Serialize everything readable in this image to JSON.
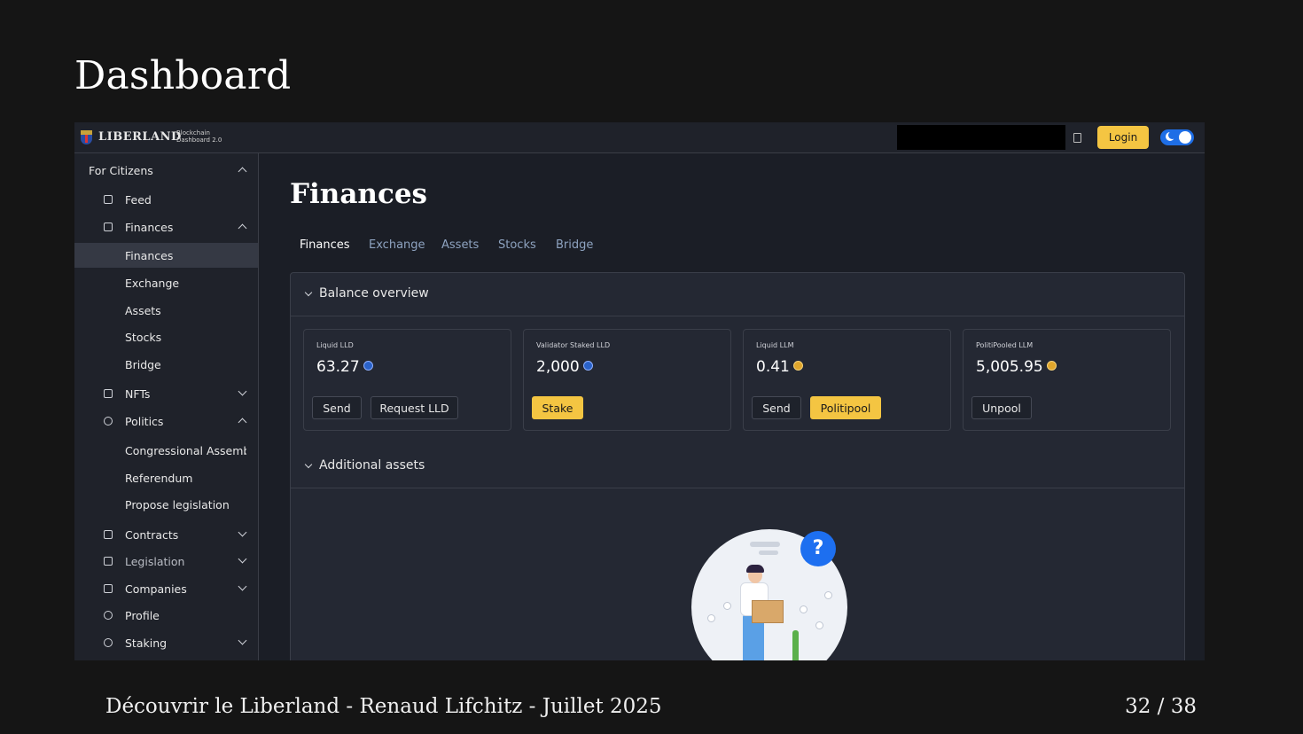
{
  "slide": {
    "title": "Dashboard",
    "footer": "Découvrir le Liberland - Renaud Lifchitz - Juillet 2025",
    "page": "32 / 38"
  },
  "app": {
    "logo": "LIBERLAND",
    "logo_sub": "Blockchain Dashboard 2.0",
    "login_label": "Login",
    "theme_icon": "moon-icon",
    "accent_color": "#f4c542",
    "toggle_color": "#1e6ee6"
  },
  "sidebar": {
    "items": [
      {
        "label": "For Citizens",
        "icon": "none",
        "chevron": "up"
      },
      {
        "label": "Feed",
        "icon": "grid-icon"
      },
      {
        "label": "Finances",
        "icon": "wallet-icon",
        "chevron": "up"
      },
      {
        "label": "Finances",
        "active": true
      },
      {
        "label": "Exchange"
      },
      {
        "label": "Assets"
      },
      {
        "label": "Stocks"
      },
      {
        "label": "Bridge"
      },
      {
        "label": "NFTs",
        "icon": "grid-icon",
        "chevron": "down"
      },
      {
        "label": "Politics",
        "icon": "gear-icon",
        "chevron": "up"
      },
      {
        "label": "Congressional Assembly"
      },
      {
        "label": "Referendum"
      },
      {
        "label": "Propose legislation"
      },
      {
        "label": "Contracts",
        "icon": "document-icon",
        "chevron": "down"
      },
      {
        "label": "Legislation",
        "icon": "scroll-icon",
        "chevron": "down"
      },
      {
        "label": "Companies",
        "icon": "building-icon",
        "chevron": "down"
      },
      {
        "label": "Profile",
        "icon": "profile-icon"
      },
      {
        "label": "Staking",
        "icon": "coins-icon",
        "chevron": "down"
      }
    ]
  },
  "main": {
    "title": "Finances",
    "tabs": [
      {
        "label": "Finances",
        "active": true
      },
      {
        "label": "Exchange"
      },
      {
        "label": "Assets"
      },
      {
        "label": "Stocks"
      },
      {
        "label": "Bridge"
      }
    ],
    "balance_overview": {
      "label": "Balance overview",
      "cards": [
        {
          "label": "Liquid LLD",
          "value": "63.27",
          "coin": "lld-coin-icon",
          "buttons": [
            "Send",
            "Request LLD"
          ]
        },
        {
          "label": "Validator Staked LLD",
          "value": "2,000",
          "coin": "lld-coin-icon",
          "buttons": [
            "Stake"
          ]
        },
        {
          "label": "Liquid LLM",
          "value": "0.41",
          "coin": "llm-coin-icon",
          "buttons": [
            "Send",
            "Politipool"
          ]
        },
        {
          "label": "PolitiPooled LLM",
          "value": "5,005.95",
          "coin": "llm-coin-icon",
          "buttons": [
            "Unpool"
          ]
        }
      ]
    },
    "additional_assets": {
      "label": "Additional assets",
      "badge": "?"
    }
  }
}
